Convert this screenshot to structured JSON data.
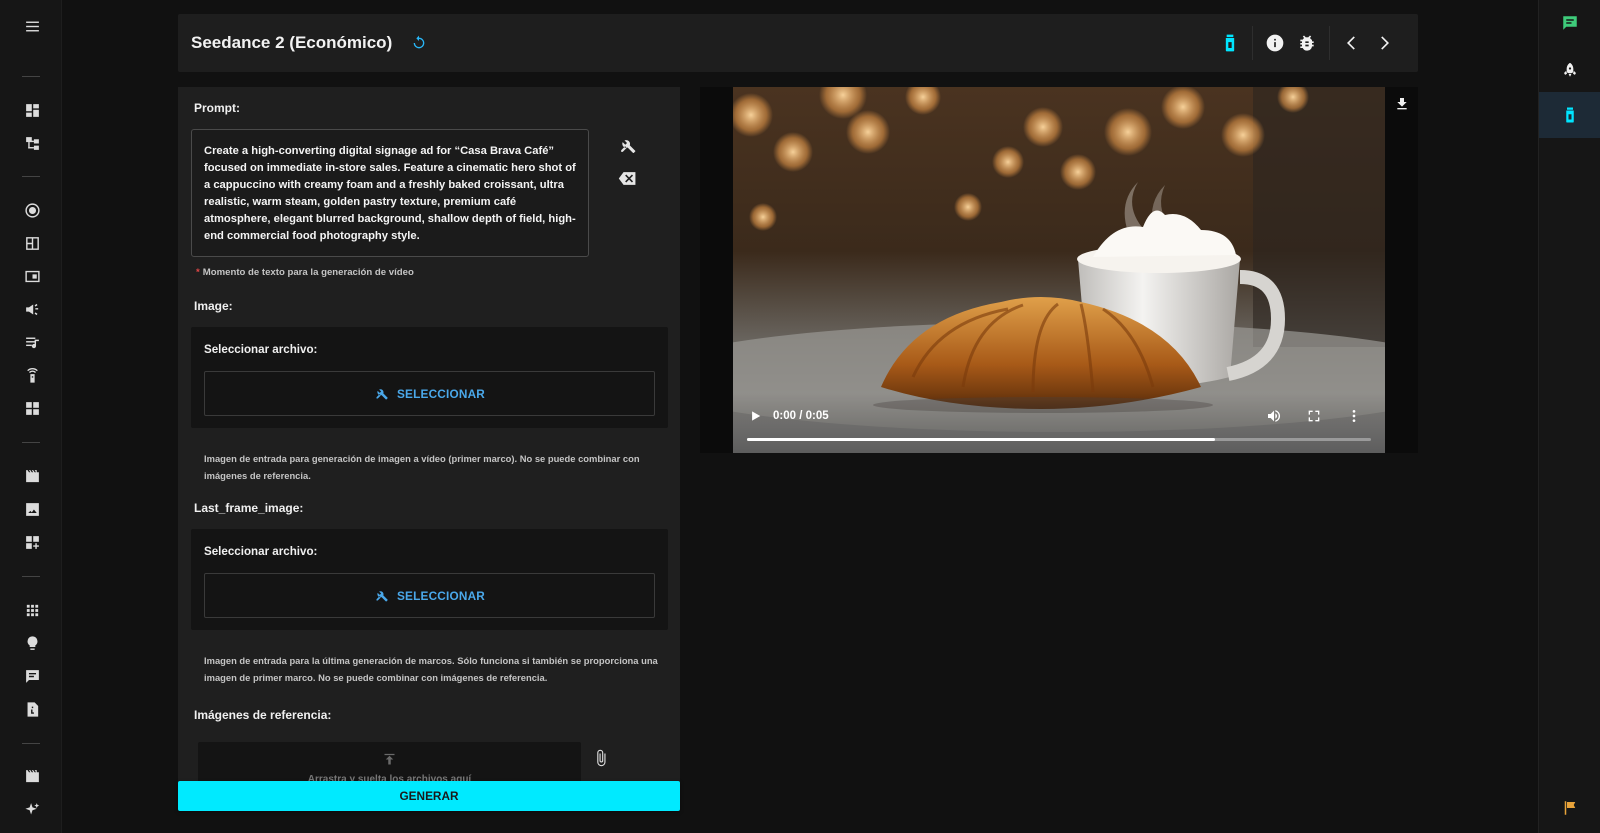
{
  "header": {
    "title": "Seedance 2 (Económico)"
  },
  "form": {
    "prompt_label": "Prompt:",
    "prompt_value": "Create a high-converting digital signage ad for “Casa Brava Café” focused on immediate in-store sales. Feature a cinematic hero shot of a cappuccino with creamy foam and a freshly baked croissant, ultra realistic, warm steam, golden pastry texture, premium café atmosphere, elegant blurred background, shallow depth of field, high-end commercial food photography style.",
    "prompt_hint": "Momento de texto para la generación de vídeo",
    "image_label": "Image:",
    "image_card_label": "Seleccionar archivo:",
    "image_select_label": "SELECCIONAR",
    "image_desc": "Imagen de entrada para generación de imagen a vídeo (primer marco). No se puede combinar con imágenes de referencia.",
    "last_frame_label": "Last_frame_image:",
    "last_frame_card_label": "Seleccionar archivo:",
    "last_frame_select_label": "SELECCIONAR",
    "last_frame_desc": "Imagen de entrada para la última generación de marcos. Sólo funciona si también se proporciona una imagen de primer marco. No se puede combinar con imágenes de referencia.",
    "ref_images_label": "Imágenes de referencia:",
    "drop_text": "Arrastra y suelta los archivos aquí",
    "generate_label": "GENERAR"
  },
  "video": {
    "time": "0:00 / 0:05",
    "progress": 0.75
  },
  "colors": {
    "accent": "#00eaff",
    "link": "#4aa8ea",
    "panel": "#1f1f1f",
    "background": "#111111",
    "flag": "#e8a33a",
    "chat": "#3ecb7a"
  },
  "icons": {
    "left_nav": [
      "menu-icon",
      "dashboard-icon",
      "hierarchy-icon",
      "record-icon",
      "layout-icon",
      "picture-in-picture-icon",
      "campaign-icon",
      "playlist-icon",
      "remote-icon",
      "widgets-icon",
      "movie-icon",
      "image-icon",
      "add-widget-icon",
      "apps-icon",
      "bulb-icon",
      "chat-icon",
      "document-icon",
      "movie-icon",
      "sparkle-icon"
    ],
    "header": [
      "bottle-icon",
      "info-icon",
      "bug-icon",
      "chevron-left-icon",
      "chevron-right-icon"
    ],
    "right_rail": [
      "chat-icon",
      "rocket-icon",
      "bottle-icon",
      "flag-icon"
    ]
  }
}
